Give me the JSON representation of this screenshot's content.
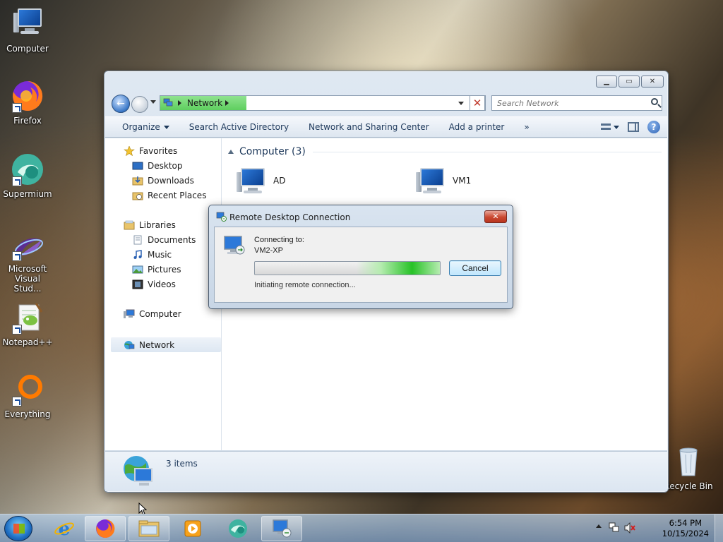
{
  "desktop": {
    "icons": [
      {
        "label": "Computer"
      },
      {
        "label": "Firefox"
      },
      {
        "label": "Supermium"
      },
      {
        "label": "Microsoft Visual Stud..."
      },
      {
        "label": "Notepad++"
      },
      {
        "label": "Everything"
      },
      {
        "label": "Recycle Bin"
      }
    ]
  },
  "explorer": {
    "address": {
      "crumb": "Network"
    },
    "search": {
      "placeholder": "Search Network"
    },
    "toolbar": {
      "organize": "Organize",
      "search_ad": "Search Active Directory",
      "network_center": "Network and Sharing Center",
      "add_printer": "Add a printer",
      "more": "»"
    },
    "navpane": {
      "favorites": "Favorites",
      "desktop": "Desktop",
      "downloads": "Downloads",
      "recent": "Recent Places",
      "libraries": "Libraries",
      "documents": "Documents",
      "music": "Music",
      "pictures": "Pictures",
      "videos": "Videos",
      "computer": "Computer",
      "network": "Network"
    },
    "group": {
      "header": "Computer (3)"
    },
    "items": [
      {
        "label": "AD"
      },
      {
        "label": "VM1"
      }
    ],
    "details": {
      "count": "3 items"
    }
  },
  "rdc": {
    "title": "Remote Desktop Connection",
    "close": "✕",
    "connecting_label": "Connecting to:",
    "target": "VM2-XP",
    "cancel": "Cancel",
    "status": "Initiating remote connection...",
    "progress_fraction": 0.45
  },
  "taskbar": {
    "time": "6:54 PM",
    "date": "10/15/2024"
  },
  "colors": {
    "accent": "#3a78c8",
    "progress_green": "#27c227",
    "close_red": "#c9472f"
  }
}
